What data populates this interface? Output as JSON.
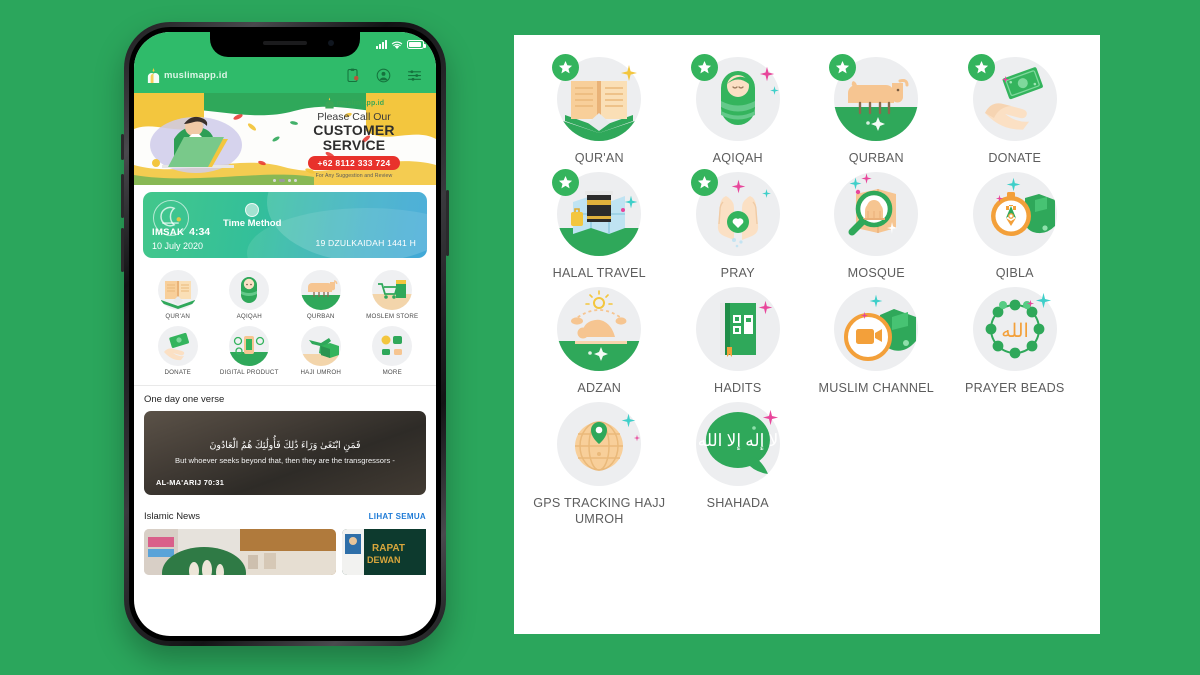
{
  "theme": {
    "background_green": "#2ba65c",
    "app_header_green": "#2fbb6a",
    "accent_green": "#34b45d",
    "panel_white": "#ffffff",
    "label_grey": "#5d5d5d",
    "link_blue": "#1f7bd6",
    "cta_red": "#e8322c"
  },
  "phone": {
    "status_bar": {
      "signal_icon": "signal-bars-icon",
      "wifi_icon": "wifi-icon",
      "battery_icon": "battery-icon"
    },
    "header": {
      "brand": "muslimapp.id",
      "brand_logo_icon": "mosque-dome-logo-icon",
      "icons": [
        {
          "name": "notification-clipboard-icon",
          "badge": true
        },
        {
          "name": "user-profile-icon",
          "badge": false
        },
        {
          "name": "settings-sliders-icon",
          "badge": false
        }
      ]
    },
    "banner": {
      "brand": "muslimapp.id",
      "line1": "Please Call Our",
      "line2a": "CUSTOMER",
      "line2b": "SERVICE",
      "phone_number": "+62 8112 333 724",
      "subtitle": "For Any Suggestion and Review",
      "illustration": "person-at-laptop-illustration",
      "dots": 4,
      "active_dot": 2
    },
    "prayer_widget": {
      "moon_icon": "crescent-moon-icon",
      "time_method_icon": "sun-circle-icon",
      "time_method_label": "Time Method",
      "prayer_name": "IMSAK",
      "prayer_time": "4:34",
      "gregorian_date": "10 July 2020",
      "hijri_date": "19 DZULKAIDAH 1441 H"
    },
    "menu": [
      {
        "label": "QUR'AN",
        "icon": "open-quran-book-icon"
      },
      {
        "label": "AQIQAH",
        "icon": "swaddled-baby-icon"
      },
      {
        "label": "QURBAN",
        "icon": "cow-icon"
      },
      {
        "label": "MOSLEM STORE",
        "icon": "shopping-cart-icon"
      },
      {
        "label": "DONATE",
        "icon": "hand-with-money-icon"
      },
      {
        "label": "DIGITAL PRODUCT",
        "icon": "digital-product-icon"
      },
      {
        "label": "HAJI UMROH",
        "icon": "plane-kaaba-icon"
      },
      {
        "label": "MORE",
        "icon": "more-grid-icon"
      }
    ],
    "verse": {
      "section_title": "One day one verse",
      "arabic": "فَمَنِ ابْتَغَىٰ وَرَاءَ ذَٰلِكَ فَأُولَٰئِكَ هُمُ الْعَادُونَ",
      "translation": "But whoever seeks beyond that, then they are the transgressors -",
      "reference": "AL-MA'ARIJ 70:31"
    },
    "news": {
      "section_title": "Islamic News",
      "see_all": "LIHAT SEMUA",
      "cards": [
        {
          "name": "news-card-primary",
          "headline": ""
        },
        {
          "name": "news-card-secondary",
          "headline": "RAPAT DEWAN"
        }
      ]
    }
  },
  "features": [
    {
      "label": "QUR'AN",
      "icon": "open-quran-book-icon",
      "starred": true
    },
    {
      "label": "AQIQAH",
      "icon": "swaddled-baby-icon",
      "starred": true
    },
    {
      "label": "QURBAN",
      "icon": "cow-icon",
      "starred": true
    },
    {
      "label": "DONATE",
      "icon": "hand-with-money-icon",
      "starred": true
    },
    {
      "label": "HALAL TRAVEL",
      "icon": "kaaba-map-icon",
      "starred": true
    },
    {
      "label": "PRAY",
      "icon": "praying-hands-icon",
      "starred": true
    },
    {
      "label": "MOSQUE",
      "icon": "mosque-magnifier-icon",
      "starred": false
    },
    {
      "label": "QIBLA",
      "icon": "compass-kaaba-icon",
      "starred": false
    },
    {
      "label": "ADZAN",
      "icon": "sujud-prayer-icon",
      "starred": false
    },
    {
      "label": "HADITS",
      "icon": "hadith-book-icon",
      "starred": false
    },
    {
      "label": "MUSLIM CHANNEL",
      "icon": "video-camera-kaaba-icon",
      "starred": false
    },
    {
      "label": "PRAYER BEADS",
      "icon": "tasbih-beads-icon",
      "starred": false
    },
    {
      "label": "GPS TRACKING HAJJ UMROH",
      "icon": "globe-pin-icon",
      "starred": false
    },
    {
      "label": "SHAHADA",
      "icon": "shahada-speech-bubble-icon",
      "starred": false
    }
  ]
}
